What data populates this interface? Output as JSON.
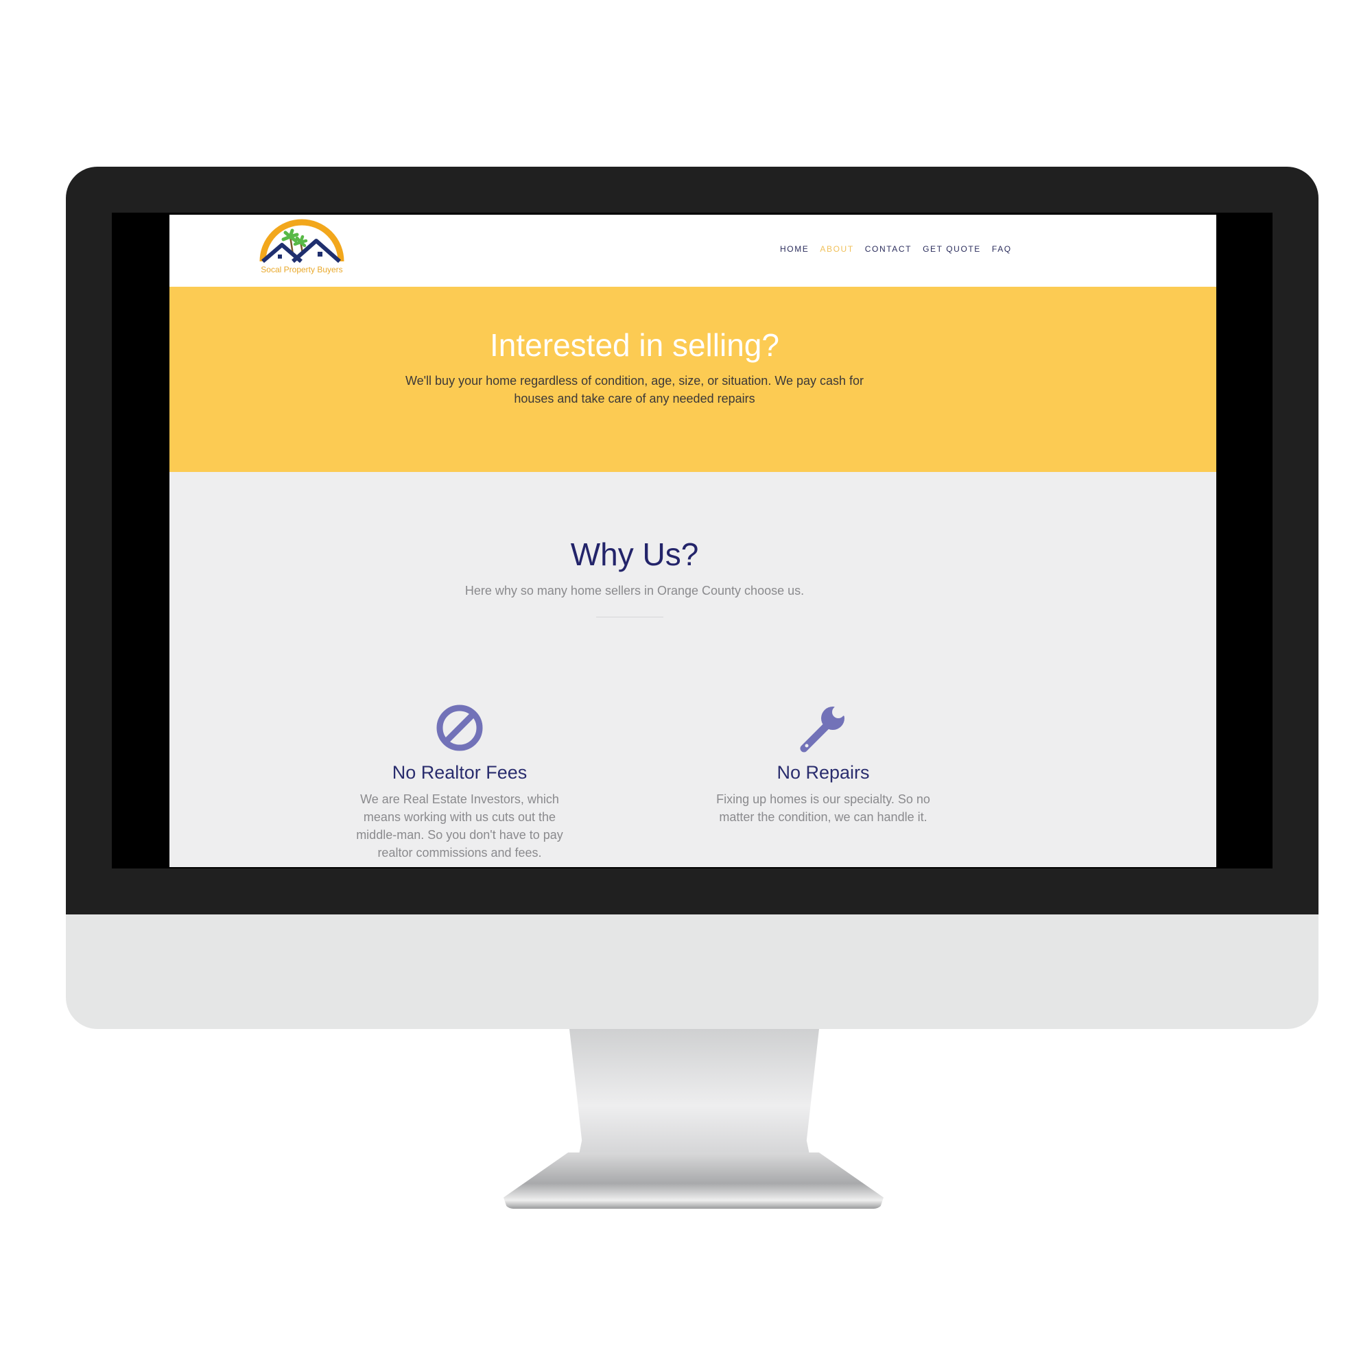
{
  "brand": {
    "logo_text": "Socal Property Buyers"
  },
  "nav": {
    "items": [
      {
        "label": "HOME",
        "active": false
      },
      {
        "label": "ABOUT",
        "active": true
      },
      {
        "label": "CONTACT",
        "active": false
      },
      {
        "label": "GET QUOTE",
        "active": false
      },
      {
        "label": "FAQ",
        "active": false
      }
    ]
  },
  "hero": {
    "title": "Interested in selling?",
    "text": "We'll buy your home regardless of condition, age, size, or situation. We pay cash for houses and take care of any needed repairs"
  },
  "why": {
    "title": "Why Us?",
    "subtitle": "Here why so many home sellers in Orange County choose us."
  },
  "features": [
    {
      "icon": "no-sign-icon",
      "title": "No Realtor Fees",
      "text": "We are Real Estate Investors, which means working with us cuts out the middle-man. So you don't have to pay realtor commissions and fees."
    },
    {
      "icon": "wrench-icon",
      "title": "No Repairs",
      "text": "Fixing up homes is our specialty. So no matter the condition, we can handle it."
    }
  ],
  "colors": {
    "hero_bg": "#fccb53",
    "primary_text": "#23246a",
    "icon": "#7272b8",
    "active_nav": "#f0c05a",
    "section_bg": "#eeeeef"
  }
}
